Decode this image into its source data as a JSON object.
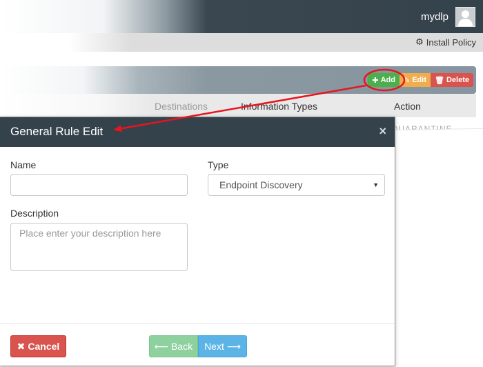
{
  "header": {
    "username": "mydlp",
    "avatar_icon": "user-avatar-icon"
  },
  "policy_bar": {
    "install_label": "Install Policy",
    "install_icon": "gear-icon"
  },
  "rule_toolbar": {
    "add_label": "Add",
    "edit_label": "Edit",
    "delete_label": "Delete",
    "colors": {
      "add": "#4cae4c",
      "edit": "#f0ad4e",
      "delete": "#d9534f"
    }
  },
  "rules_table": {
    "columns": [
      "Destinations",
      "Information Types",
      "Action"
    ],
    "partial_row_action": "QUARANTINE"
  },
  "modal": {
    "title": "General Rule Edit",
    "close_glyph": "×",
    "name_label": "Name",
    "name_value": "",
    "type_label": "Type",
    "type_value": "Endpoint Discovery",
    "description_label": "Description",
    "description_placeholder": "Place enter your description here",
    "cancel_label": "Cancel",
    "back_label": "Back",
    "next_label": "Next",
    "colors": {
      "header": "#34424c",
      "cancel": "#d9534f",
      "back": "#8fd19e",
      "next": "#5bb4e5"
    }
  },
  "annotation": {
    "color": "#e8141e"
  }
}
